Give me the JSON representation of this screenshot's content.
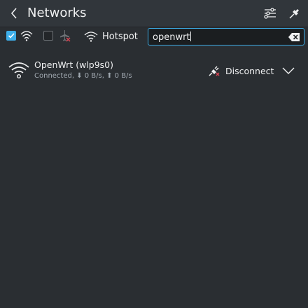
{
  "header": {
    "title": "Networks",
    "back_icon": "chevron-left-icon",
    "configure_icon": "sliders-icon",
    "pin_icon": "pin-icon"
  },
  "toolbar": {
    "wifi_enabled": true,
    "airplane_mode": false,
    "hotspot_label": "Hotspot",
    "search": {
      "value": "openwrt",
      "placeholder": ""
    }
  },
  "connections": [
    {
      "name": "OpenWrt (wlp9s0)",
      "status": "Connected, ⬇ 0 B/s, ⬆ 0 B/s",
      "action_label": "Disconnect",
      "icon": "wifi-connected-icon"
    }
  ],
  "colors": {
    "accent": "#3daee9",
    "background": "#2a2e32",
    "header": "#31363b",
    "text": "#eff0f1",
    "subtext": "#a1a9b1",
    "danger": "#da4453"
  }
}
